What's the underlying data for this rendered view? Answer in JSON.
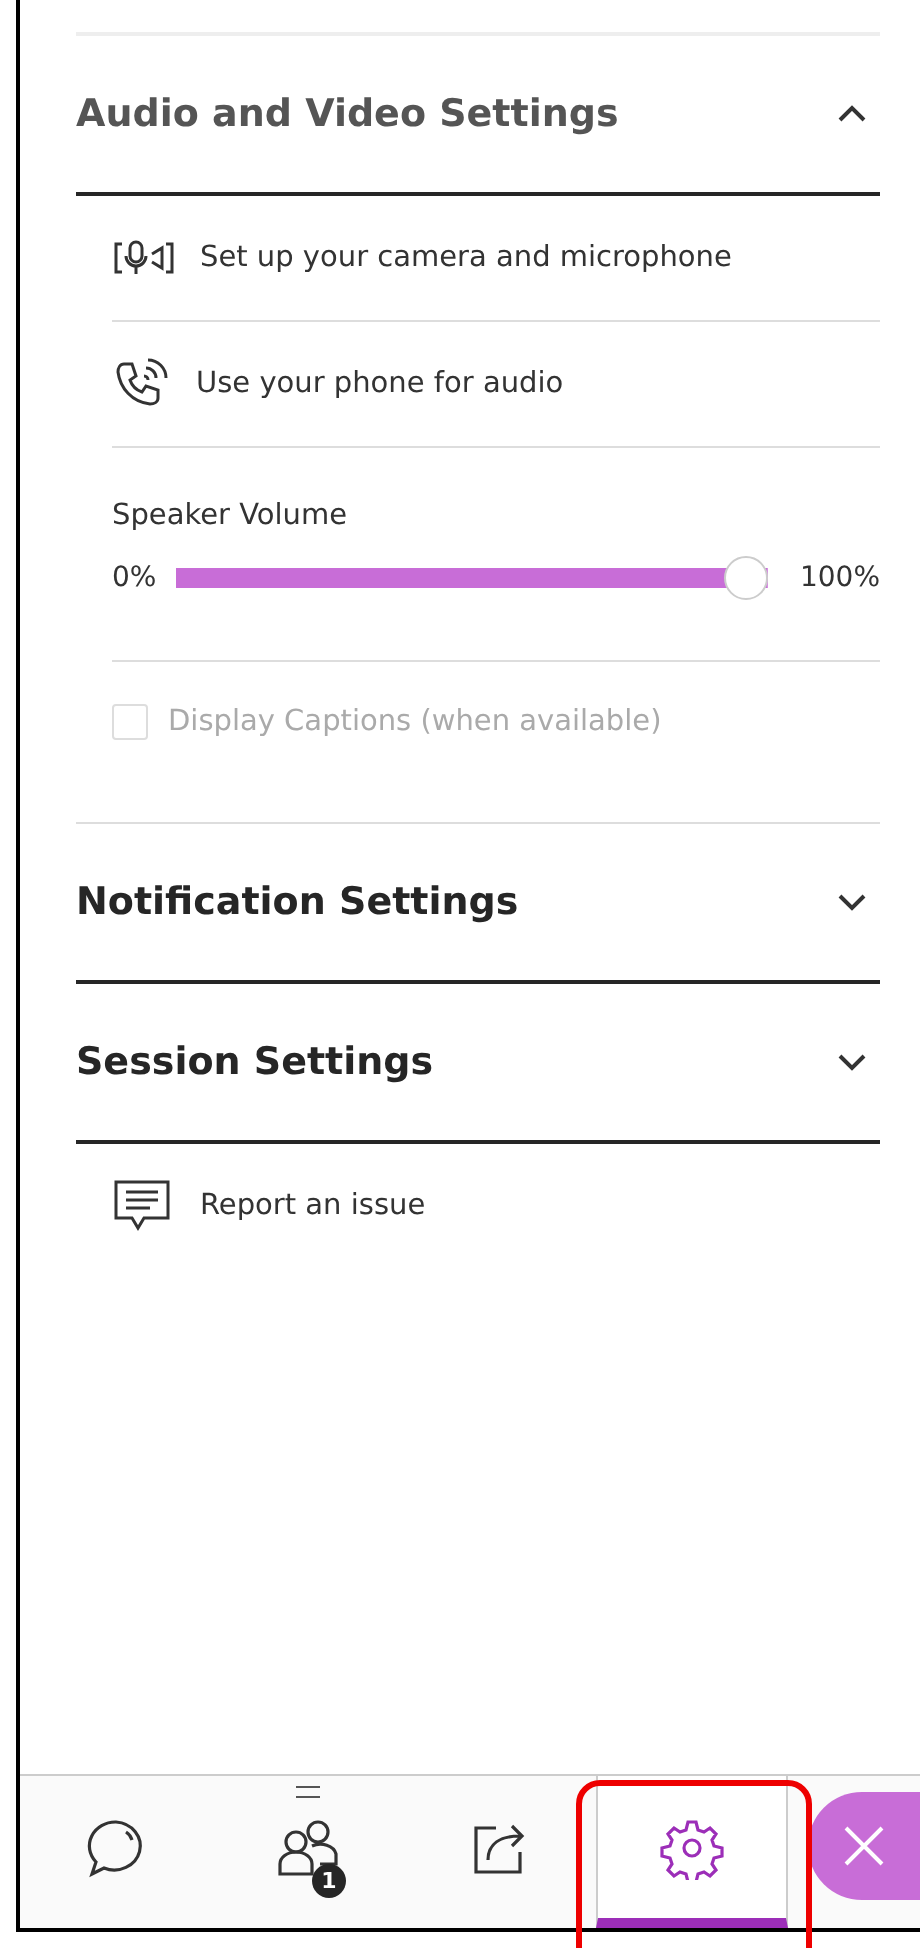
{
  "sections": [
    {
      "title": "Audio and Video Settings",
      "expanded": true,
      "items": [
        {
          "kind": "camera",
          "label": "Set up your camera and microphone"
        },
        {
          "kind": "phone",
          "label": "Use your phone for audio"
        },
        {
          "kind": "slider",
          "label": "Speaker Volume",
          "min_label": "0%",
          "max_label": "100%",
          "level": 1
        },
        {
          "kind": "checkbox",
          "label": "Display Captions (when available)",
          "checked": false,
          "disabled": true
        }
      ]
    },
    {
      "title": "Notification Settings",
      "expanded": false
    },
    {
      "title": "Session Settings",
      "expanded": false
    }
  ],
  "report": {
    "label": "Report an issue"
  },
  "tabs": [
    {
      "kind": "chat",
      "selected": false
    },
    {
      "kind": "people",
      "selected": false,
      "badge": "1"
    },
    {
      "kind": "share",
      "selected": false
    },
    {
      "kind": "settings",
      "selected": true
    }
  ]
}
